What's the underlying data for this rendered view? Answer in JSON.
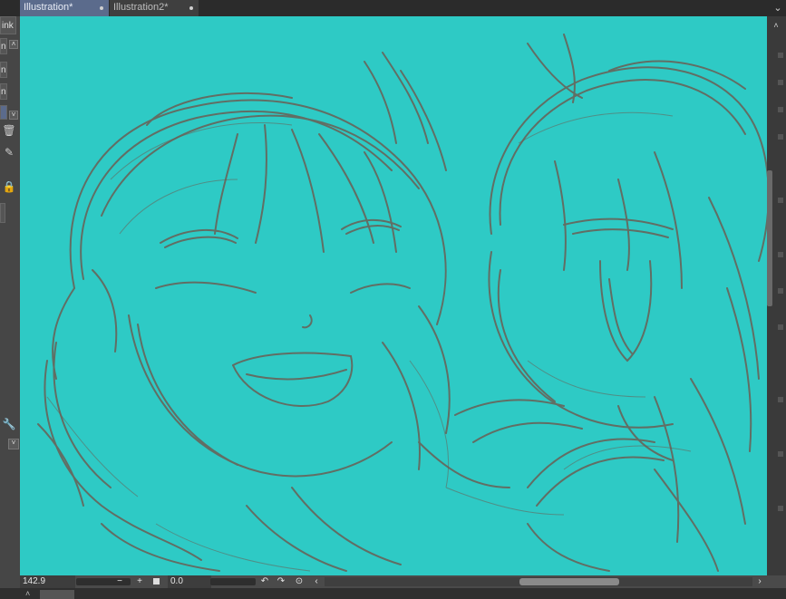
{
  "tabs": [
    {
      "label": "Illustration*",
      "active": true
    },
    {
      "label": "Illustration2*",
      "active": false
    }
  ],
  "tab_menu_icon": "chevron-down-icon",
  "left_panel": {
    "labels": [
      "ink",
      "n",
      "n",
      "n"
    ]
  },
  "navigator": {
    "zoom": "142.9",
    "rotation": "0.0"
  },
  "colors": {
    "canvas_bg": "#2ecac5",
    "sketch_stroke": "#6b5e54",
    "active_tab": "#5b6b8c"
  }
}
